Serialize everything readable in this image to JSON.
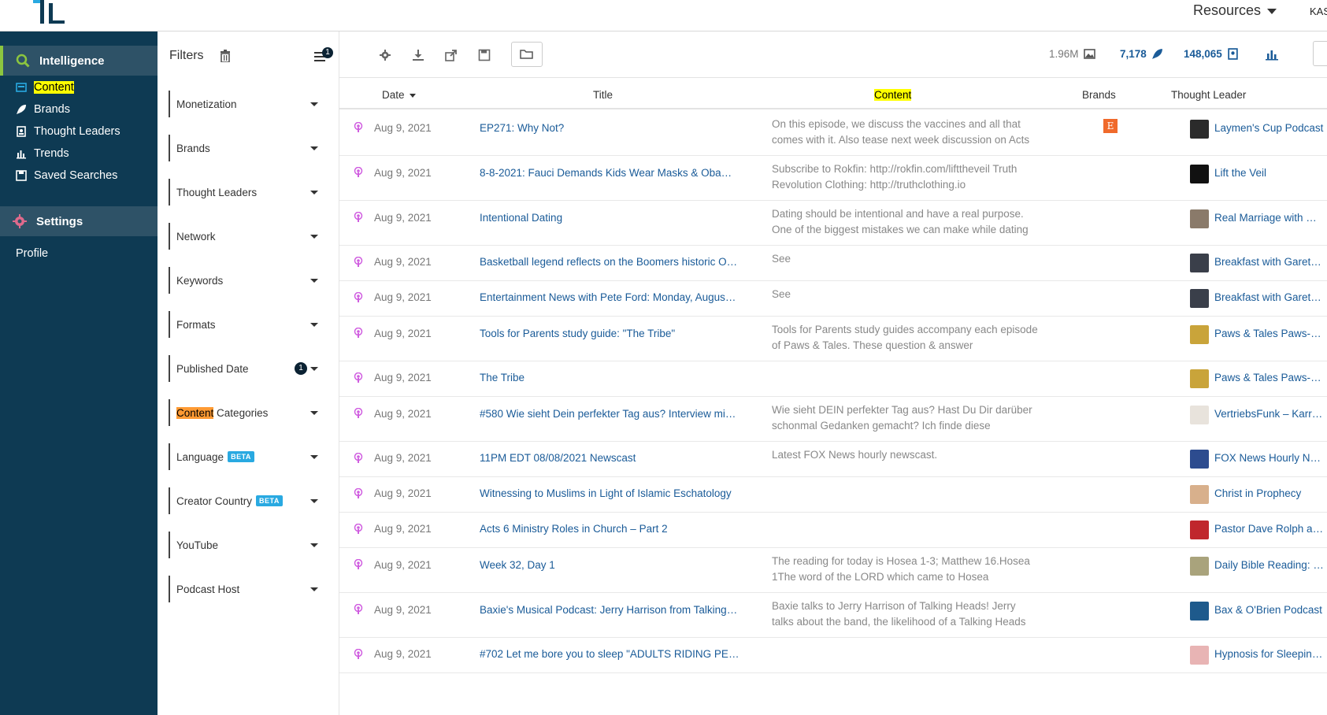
{
  "topbar": {
    "resources_label": "Resources",
    "user_initials": "KAS"
  },
  "sidebar": {
    "intelligence_label": "Intelligence",
    "items": [
      {
        "label": "Content",
        "icon": "content-icon"
      },
      {
        "label": "Brands",
        "icon": "rocket-icon"
      },
      {
        "label": "Thought Leaders",
        "icon": "badge-icon"
      },
      {
        "label": "Trends",
        "icon": "bar-chart-icon"
      },
      {
        "label": "Saved Searches",
        "icon": "save-icon"
      }
    ],
    "settings_label": "Settings",
    "profile_label": "Profile"
  },
  "filters": {
    "title": "Filters",
    "active_count": "1",
    "items": [
      {
        "label": "Monetization"
      },
      {
        "label": "Brands"
      },
      {
        "label": "Thought Leaders"
      },
      {
        "label": "Network"
      },
      {
        "label": "Keywords"
      },
      {
        "label": "Formats"
      },
      {
        "label": "Published Date",
        "badge": "1"
      },
      {
        "label_highlight": "Content",
        "label_rest": " Categories"
      },
      {
        "label": "Language",
        "beta": "BETA"
      },
      {
        "label": "Creator Country",
        "beta": "BETA"
      },
      {
        "label": "YouTube"
      },
      {
        "label": "Podcast Host"
      }
    ]
  },
  "toolbar": {
    "stat_size": "1.96M",
    "stat_reach": "7,178",
    "stat_count": "148,065"
  },
  "table": {
    "headers": {
      "date": "Date",
      "title": "Title",
      "content": "Content",
      "brands": "Brands",
      "thought_leader": "Thought Leader"
    },
    "rows": [
      {
        "date": "Aug 9, 2021",
        "title": "EP271: Why Not?",
        "content": "On this episode, we discuss the vaccines and all that comes with it. Also tease next week discussion on Acts",
        "brand": "E",
        "tl": "Laymen's Cup Podcast",
        "thumb": "#2b2b2b",
        "h": 57
      },
      {
        "date": "Aug 9, 2021",
        "title": "8-8-2021: Fauci Demands Kids Wear Masks & Obam…",
        "content": "Subscribe to Rokfin: http://rokfin.com/lifttheveil Truth Revolution Clothing: http://truthclothing.io",
        "brand": "",
        "tl": "Lift the Veil",
        "thumb": "#111111",
        "h": 57
      },
      {
        "date": "Aug 9, 2021",
        "title": "Intentional Dating",
        "content": "Dating should be intentional and have a real purpose. One of the biggest mistakes we can make while dating",
        "brand": "",
        "tl": "Real Marriage with …",
        "thumb": "#8a7a6a",
        "h": 57
      },
      {
        "date": "Aug 9, 2021",
        "title": "Basketball legend reflects on the Boomers historic O…",
        "content": "See",
        "brand": "",
        "tl": "Breakfast with Garet…",
        "thumb": "#3a3f4a",
        "h": 45
      },
      {
        "date": "Aug 9, 2021",
        "title": "Entertainment News with Pete Ford: Monday, Augus…",
        "content": "See",
        "brand": "",
        "tl": "Breakfast with Garet…",
        "thumb": "#3a3f4a",
        "h": 45
      },
      {
        "date": "Aug 9, 2021",
        "title": "Tools for Parents study guide: \"The Tribe\"",
        "content": "Tools for Parents study guides accompany each episode of Paws & Tales. These question & answer",
        "brand": "",
        "tl": "Paws & Tales Paws-c…",
        "thumb": "#c9a43a",
        "h": 57
      },
      {
        "date": "Aug 9, 2021",
        "title": "The Tribe",
        "content": "",
        "brand": "",
        "tl": "Paws & Tales Paws-c…",
        "thumb": "#c9a43a",
        "h": 45
      },
      {
        "date": "Aug 9, 2021",
        "title": "#580 Wie sieht Dein perfekter Tag aus? Interview mi…",
        "content": "Wie sieht DEIN perfekter Tag aus? Hast Du Dir darüber schonmal Gedanken gemacht? Ich finde diese",
        "brand": "",
        "tl": "VertriebsFunk – Karr…",
        "thumb": "#e8e3dc",
        "h": 57
      },
      {
        "date": "Aug 9, 2021",
        "title": "11PM EDT 08/08/2021 Newscast",
        "content": "Latest FOX News hourly newscast.",
        "brand": "",
        "tl": "FOX News Hourly N…",
        "thumb": "#2d4c8f",
        "h": 45
      },
      {
        "date": "Aug 9, 2021",
        "title": "Witnessing to Muslims in Light of Islamic Eschatology",
        "content": "",
        "brand": "",
        "tl": "Christ in Prophecy",
        "thumb": "#d8b08c",
        "h": 45
      },
      {
        "date": "Aug 9, 2021",
        "title": "Acts 6 Ministry Roles in Church – Part 2",
        "content": "",
        "brand": "",
        "tl": "Pastor Dave Rolph at …",
        "thumb": "#c0272d",
        "h": 45
      },
      {
        "date": "Aug 9, 2021",
        "title": "Week 32, Day 1",
        "content": "The reading for today is Hosea 1-3; Matthew 16.Hosea 1The word of the LORD which came to Hosea",
        "brand": "",
        "tl": "Daily Bible Reading: …",
        "thumb": "#a9a37c",
        "h": 57
      },
      {
        "date": "Aug 9, 2021",
        "title": "Baxie's Musical Podcast: Jerry Harrison from Talking …",
        "content": "Baxie talks to Jerry Harrison of Talking Heads! Jerry talks about the band, the likelihood of a Talking Heads",
        "brand": "",
        "tl": "Bax & O'Brien Podcast",
        "thumb": "#1e5a8c",
        "h": 57
      },
      {
        "date": "Aug 9, 2021",
        "title": "#702 Let me bore you to sleep \"ADULTS RIDING PE…",
        "content": "",
        "brand": "",
        "tl": "Hypnosis for Sleepin…",
        "thumb": "#e8b4b4",
        "h": 45
      }
    ]
  }
}
